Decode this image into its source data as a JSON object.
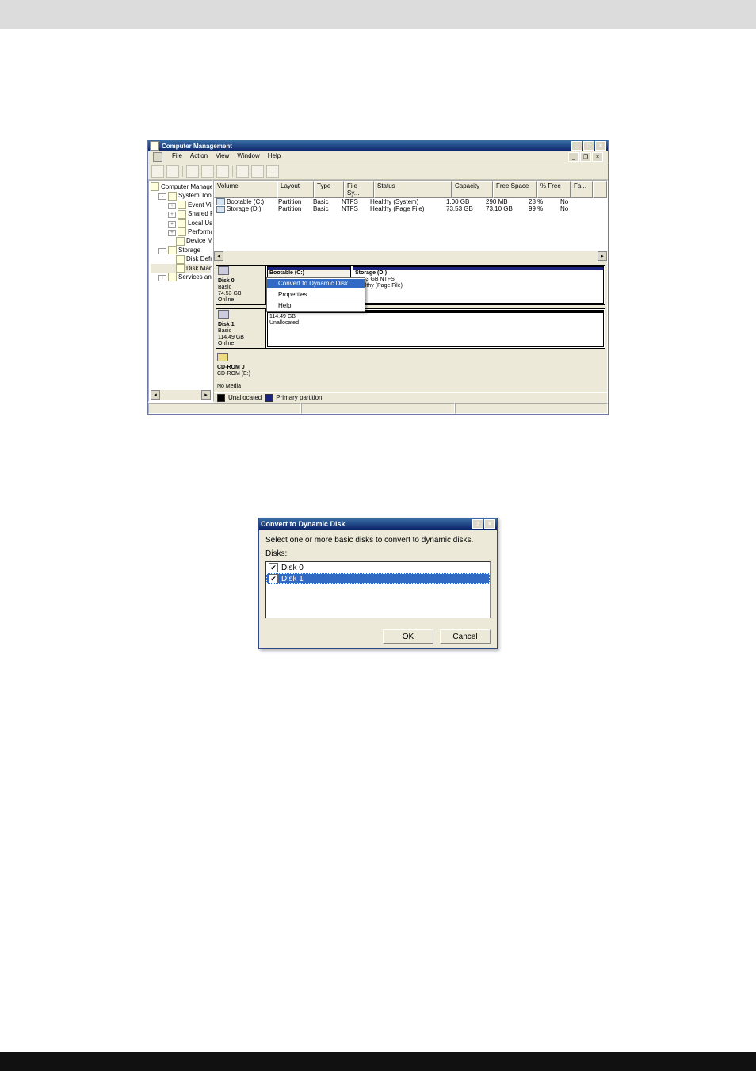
{
  "cm_window": {
    "title": "Computer Management",
    "menus": [
      "File",
      "Action",
      "View",
      "Window",
      "Help"
    ],
    "tree": {
      "root": "Computer Management (Local)",
      "items": [
        {
          "label": "System Tools",
          "expanded": true,
          "children": [
            {
              "label": "Event Viewer",
              "expandable": true
            },
            {
              "label": "Shared Folders",
              "expandable": true
            },
            {
              "label": "Local Users and Groups",
              "expandable": true
            },
            {
              "label": "Performance Logs and Alerts",
              "expandable": true
            },
            {
              "label": "Device Manager",
              "expandable": false
            }
          ]
        },
        {
          "label": "Storage",
          "expanded": true,
          "children": [
            {
              "label": "Disk Defragmenter",
              "expandable": false
            },
            {
              "label": "Disk Management",
              "expandable": false,
              "selected": true
            }
          ]
        },
        {
          "label": "Services and Applications",
          "expandable": true
        }
      ]
    },
    "volume_grid": {
      "columns": [
        "Volume",
        "Layout",
        "Type",
        "File Sy...",
        "Status",
        "Capacity",
        "Free Space",
        "% Free",
        "Fa...",
        ""
      ],
      "rows": [
        {
          "volume": "Bootable (C:)",
          "layout": "Partition",
          "type": "Basic",
          "fs": "NTFS",
          "status": "Healthy (System)",
          "capacity": "1.00 GB",
          "free": "290 MB",
          "pct": "28 %",
          "fa": "No"
        },
        {
          "volume": "Storage (D:)",
          "layout": "Partition",
          "type": "Basic",
          "fs": "NTFS",
          "status": "Healthy (Page File)",
          "capacity": "73.53 GB",
          "free": "73.10 GB",
          "pct": "99 %",
          "fa": "No"
        }
      ]
    },
    "disks": [
      {
        "title": "Disk 0",
        "type_line": "Basic",
        "size": "74.53 GB",
        "state": "Online",
        "partitions": [
          {
            "name": "Bootable  (C:)",
            "selected": true
          },
          {
            "name": "Storage  (D:)",
            "sub1": "73.53 GB NTFS",
            "sub2": "Healthy (Page File)"
          }
        ]
      },
      {
        "title": "Disk 1",
        "type_line": "Basic",
        "size": "114.49 GB",
        "state": "Online",
        "partitions": [
          {
            "name": "114.49 GB",
            "sub1": "Unallocated"
          }
        ]
      },
      {
        "title": "CD-ROM 0",
        "type_line": "CD-ROM (E:)",
        "size": "",
        "state": "No Media",
        "partitions": []
      }
    ],
    "context_menu": {
      "items": [
        "Convert to Dynamic Disk...",
        "Properties",
        "Help"
      ],
      "selected": "Convert to Dynamic Disk..."
    },
    "legend": {
      "unallocated": "Unallocated",
      "primary": "Primary partition"
    }
  },
  "convert_dialog": {
    "title": "Convert to Dynamic Disk",
    "instruction": "Select one or more basic disks to convert to dynamic disks.",
    "list_label": "Disks:",
    "disks": [
      {
        "label": "Disk 0",
        "checked": true,
        "selected": false
      },
      {
        "label": "Disk 1",
        "checked": true,
        "selected": true
      }
    ],
    "buttons": {
      "ok": "OK",
      "cancel": "Cancel"
    }
  }
}
